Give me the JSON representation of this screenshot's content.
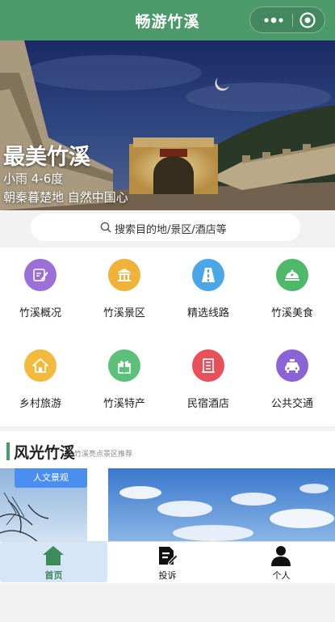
{
  "navbar": {
    "title": "畅游竹溪"
  },
  "banner": {
    "headline": "最美竹溪",
    "weather": "小雨 4-6度",
    "slogan": "朝秦暮楚地 自然中国心"
  },
  "search": {
    "placeholder": "搜索目的地/景区/酒店等"
  },
  "grid": {
    "items": [
      {
        "label": "竹溪概况",
        "color": "#9a6fd8",
        "icon": "note-edit-icon"
      },
      {
        "label": "竹溪景区",
        "color": "#f0b23a",
        "icon": "temple-icon"
      },
      {
        "label": "精选线路",
        "color": "#4aa6e8",
        "icon": "road-icon"
      },
      {
        "label": "竹溪美食",
        "color": "#4fb86a",
        "icon": "food-dome-icon"
      },
      {
        "label": "乡村旅游",
        "color": "#f3bb3d",
        "icon": "house-icon"
      },
      {
        "label": "竹溪特产",
        "color": "#5cc07a",
        "icon": "gift-icon"
      },
      {
        "label": "民宿酒店",
        "color": "#e8505a",
        "icon": "hotel-icon"
      },
      {
        "label": "公共交通",
        "color": "#8a64d6",
        "icon": "taxi-icon"
      }
    ]
  },
  "section": {
    "title": "风光竹溪",
    "subtitle": "竹溪亮点景区推荐",
    "card_tag": "人文景观"
  },
  "tabbar": {
    "items": [
      {
        "label": "首页",
        "icon": "home-icon",
        "active": true
      },
      {
        "label": "投诉",
        "icon": "complaint-icon",
        "active": false
      },
      {
        "label": "个人",
        "icon": "person-icon",
        "active": false
      }
    ]
  },
  "colors": {
    "brand": "#4c9a6a",
    "tag": "#4a8ff0",
    "tab_active_bg": "#d6e6f7"
  }
}
